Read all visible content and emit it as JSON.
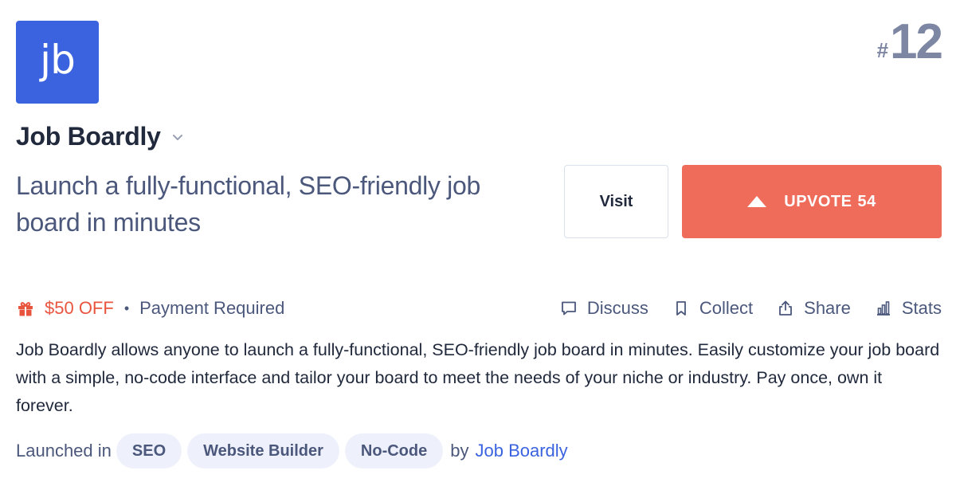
{
  "product": {
    "logo_text": "jb",
    "name": "Job Boardly",
    "tagline": "Launch a fully-functional, SEO-friendly job board in minutes",
    "description": "Job Boardly allows anyone to launch a fully-functional, SEO-friendly job board in minutes. Easily customize your job board with a simple, no-code interface and tailor your board to meet the needs of your niche or industry. Pay once, own it forever."
  },
  "rank": {
    "hash": "#",
    "number": "12"
  },
  "buttons": {
    "visit": "Visit",
    "upvote_label": "UPVOTE",
    "upvote_count": "54"
  },
  "meta": {
    "discount": "$50 OFF",
    "separator": "•",
    "pricing": "Payment Required"
  },
  "actions": [
    {
      "label": "Discuss",
      "icon": "comment-icon"
    },
    {
      "label": "Collect",
      "icon": "bookmark-icon"
    },
    {
      "label": "Share",
      "icon": "share-icon"
    },
    {
      "label": "Stats",
      "icon": "stats-icon"
    }
  ],
  "launched": {
    "prefix": "Launched in",
    "tags": [
      "SEO",
      "Website Builder",
      "No-Code"
    ],
    "by_label": "by",
    "maker": "Job Boardly"
  },
  "colors": {
    "logo_bg": "#3b63e0",
    "upvote_bg": "#ef6c5b",
    "discount": "#e8553f",
    "link": "#3b63e0",
    "rank": "#7d86a2"
  }
}
